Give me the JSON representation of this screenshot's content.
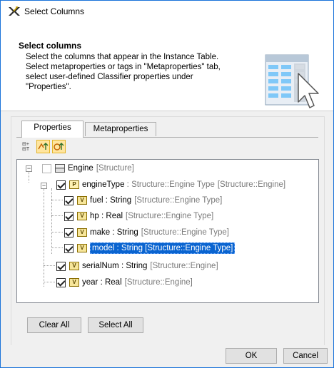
{
  "window": {
    "title": "Select Columns"
  },
  "header": {
    "title": "Select columns",
    "description": "Select the columns that appear in the Instance Table.\nSelect metaproperties or tags in \"Metaproperties\" tab,\nselect user-defined Classifier properties under\n\"Properties\"."
  },
  "tabs": [
    {
      "label": "Properties",
      "active": true
    },
    {
      "label": "Metaproperties",
      "active": false
    }
  ],
  "toolbar": [
    {
      "icon": "expand-collapse-icon"
    },
    {
      "icon": "show-inherited-icon"
    },
    {
      "icon": "show-by-type-icon"
    }
  ],
  "tree": {
    "root": {
      "name": "Engine",
      "type": "[Structure]",
      "checked": false,
      "expanded": true,
      "icon": "structure-icon"
    },
    "items": [
      {
        "name": "engineType",
        "sep": " : ",
        "typeName": "Structure::Engine Type",
        "owner": "[Structure::Engine]",
        "checked": true,
        "icon": "P",
        "expanded": true
      },
      {
        "name": "fuel",
        "sep": " : ",
        "typeName": "String",
        "owner": "[Structure::Engine Type]",
        "checked": true,
        "icon": "V"
      },
      {
        "name": "hp",
        "sep": " : ",
        "typeName": "Real",
        "owner": "[Structure::Engine Type]",
        "checked": true,
        "icon": "V"
      },
      {
        "name": "make",
        "sep": " : ",
        "typeName": "String",
        "owner": "[Structure::Engine Type]",
        "checked": true,
        "icon": "V"
      },
      {
        "name": "model",
        "sep": " : ",
        "typeName": "String",
        "owner": "[Structure::Engine Type]",
        "checked": true,
        "icon": "V",
        "selected": true
      },
      {
        "name": "serialNum",
        "sep": " : ",
        "typeName": "String",
        "owner": "[Structure::Engine]",
        "checked": true,
        "icon": "V"
      },
      {
        "name": "year",
        "sep": " : ",
        "typeName": "Real",
        "owner": "[Structure::Engine]",
        "checked": true,
        "icon": "V"
      }
    ]
  },
  "buttons": {
    "clear_all": "Clear All",
    "select_all": "Select All",
    "ok": "OK",
    "cancel": "Cancel"
  },
  "colors": {
    "accent": "#0a64d0",
    "window_border": "#1a73d9",
    "toolbar_highlight": "#ffe59e"
  }
}
